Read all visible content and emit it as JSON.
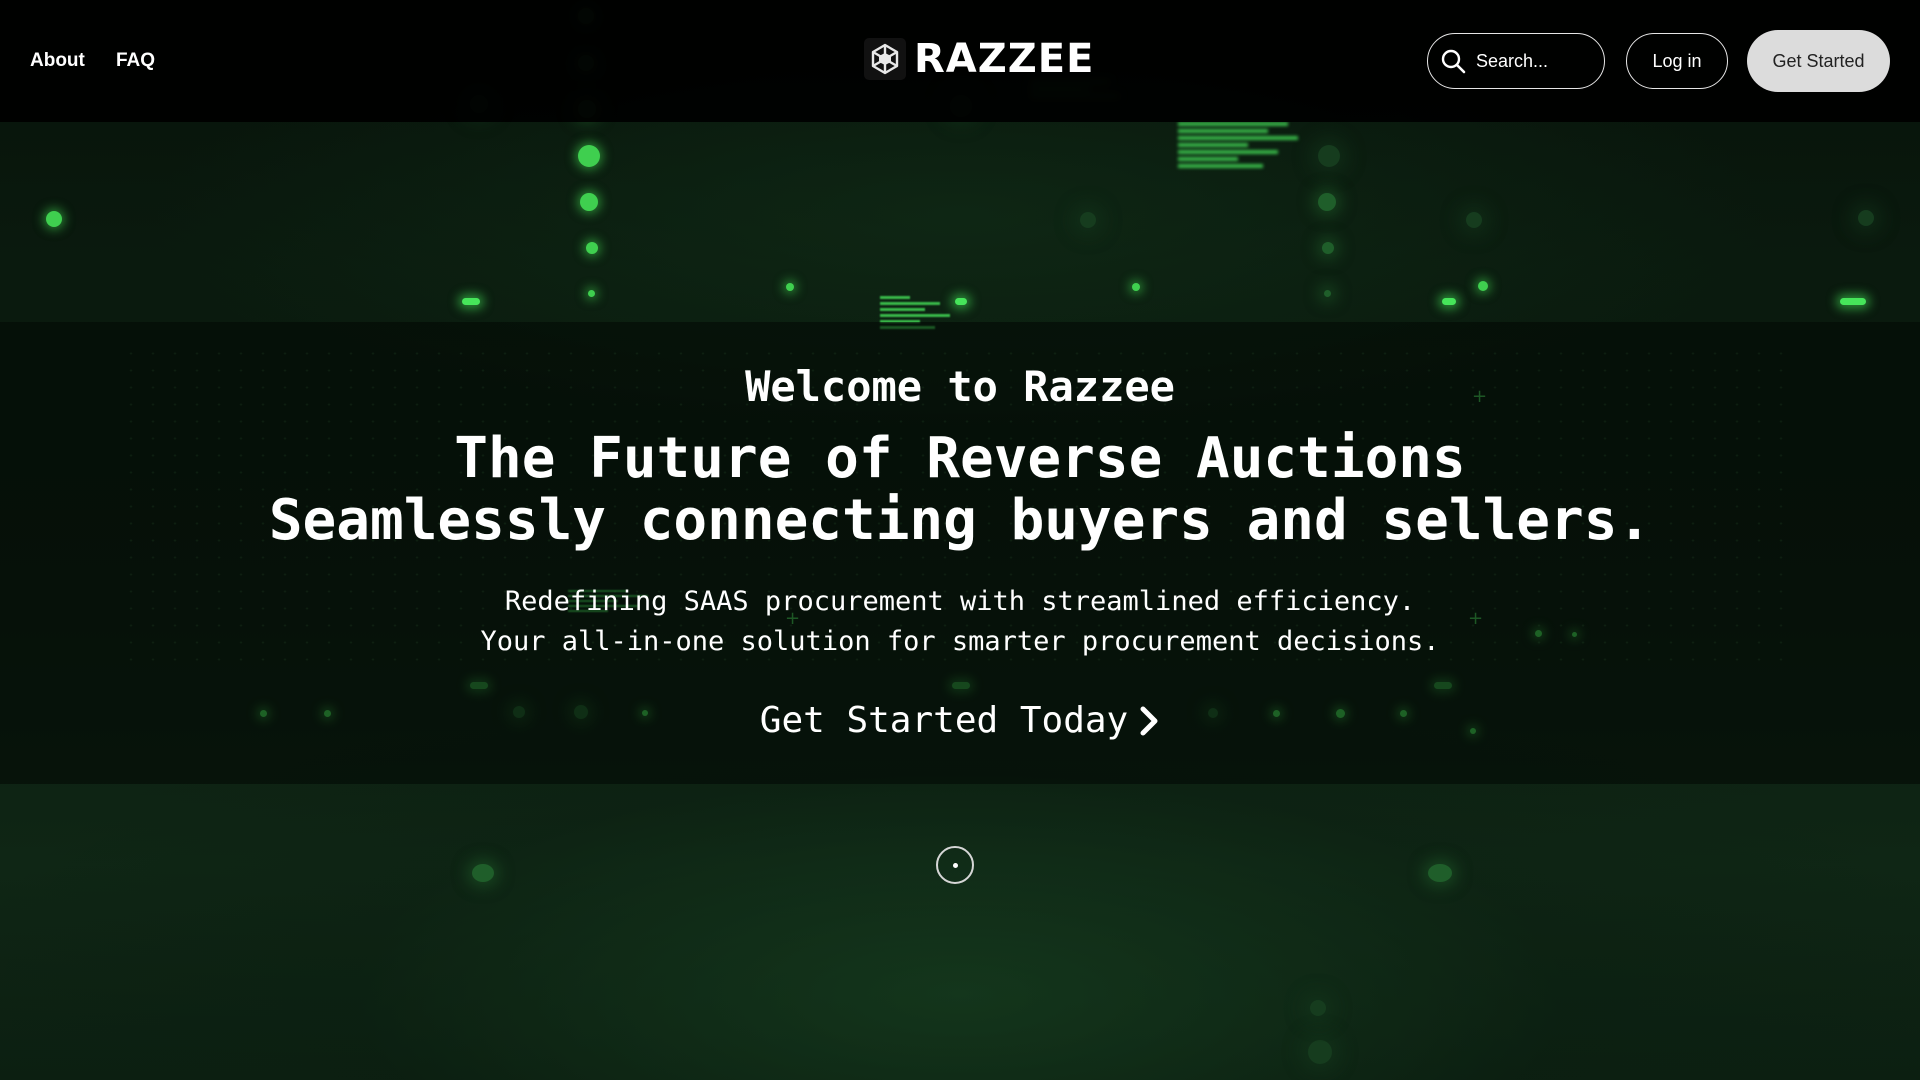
{
  "header": {
    "nav": [
      {
        "label": "About"
      },
      {
        "label": "FAQ"
      }
    ],
    "logo_text": "RAZZEE",
    "search": {
      "placeholder": "Search..."
    },
    "login_label": "Log in",
    "get_started_label": "Get Started"
  },
  "hero": {
    "welcome": "Welcome to Razzee",
    "headline_line1": "The Future of Reverse Auctions",
    "headline_line2": "Seamlessly connecting buyers and sellers.",
    "subtext_line1": "Redefining SAAS procurement with streamlined efficiency.",
    "subtext_line2": "Your all-in-one solution for smarter procurement decisions.",
    "cta_label": "Get Started Today"
  },
  "icons": {
    "logo": "razzee-logo-icon",
    "search": "search-icon",
    "cta_arrow": "chevron-right-icon",
    "scroll": "scroll-indicator-icon"
  },
  "colors": {
    "accent_green": "#3fcf4f",
    "header_bg": "#000000",
    "primary_button_bg": "#dcdcdc"
  }
}
